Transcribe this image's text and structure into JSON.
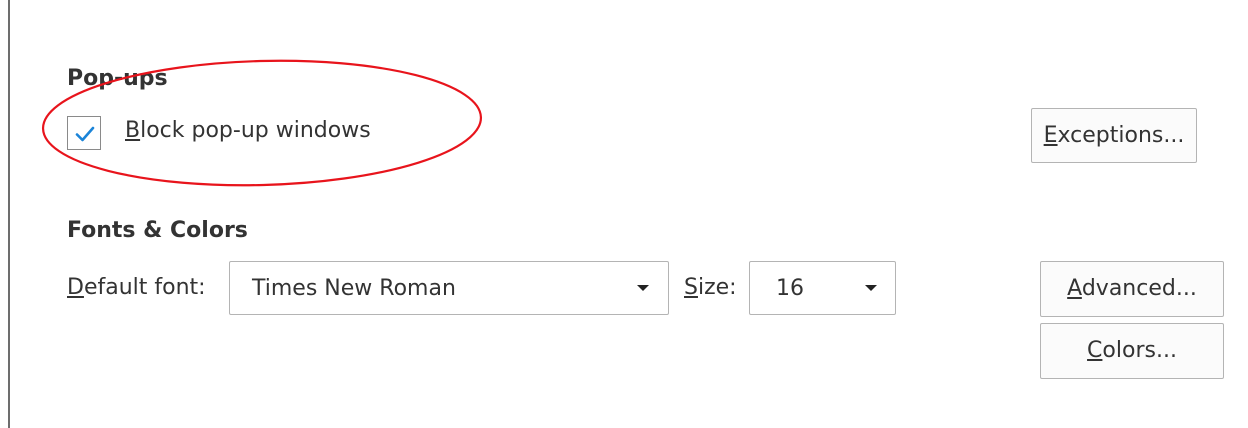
{
  "popups": {
    "heading": "Pop-ups",
    "block_checkbox": {
      "checked": true,
      "label_accesskey": "B",
      "label_rest": "lock pop-up windows"
    },
    "exceptions_button": {
      "accesskey": "E",
      "rest": "xceptions..."
    }
  },
  "fonts_colors": {
    "heading": "Fonts & Colors",
    "default_font": {
      "label_accesskey": "D",
      "label_rest": "efault font:",
      "value": "Times New Roman"
    },
    "size": {
      "label_accesskey": "S",
      "label_rest": "ize:",
      "value": "16"
    },
    "advanced_button": {
      "accesskey": "A",
      "rest": "dvanced..."
    },
    "colors_button": {
      "accesskey": "C",
      "rest": "olors..."
    }
  },
  "colors": {
    "checkmark": "#1b84d8",
    "annotation_ellipse": "#e8141c"
  },
  "icons": {
    "dropdown": "chevron-down-icon",
    "check": "checkmark-icon"
  }
}
